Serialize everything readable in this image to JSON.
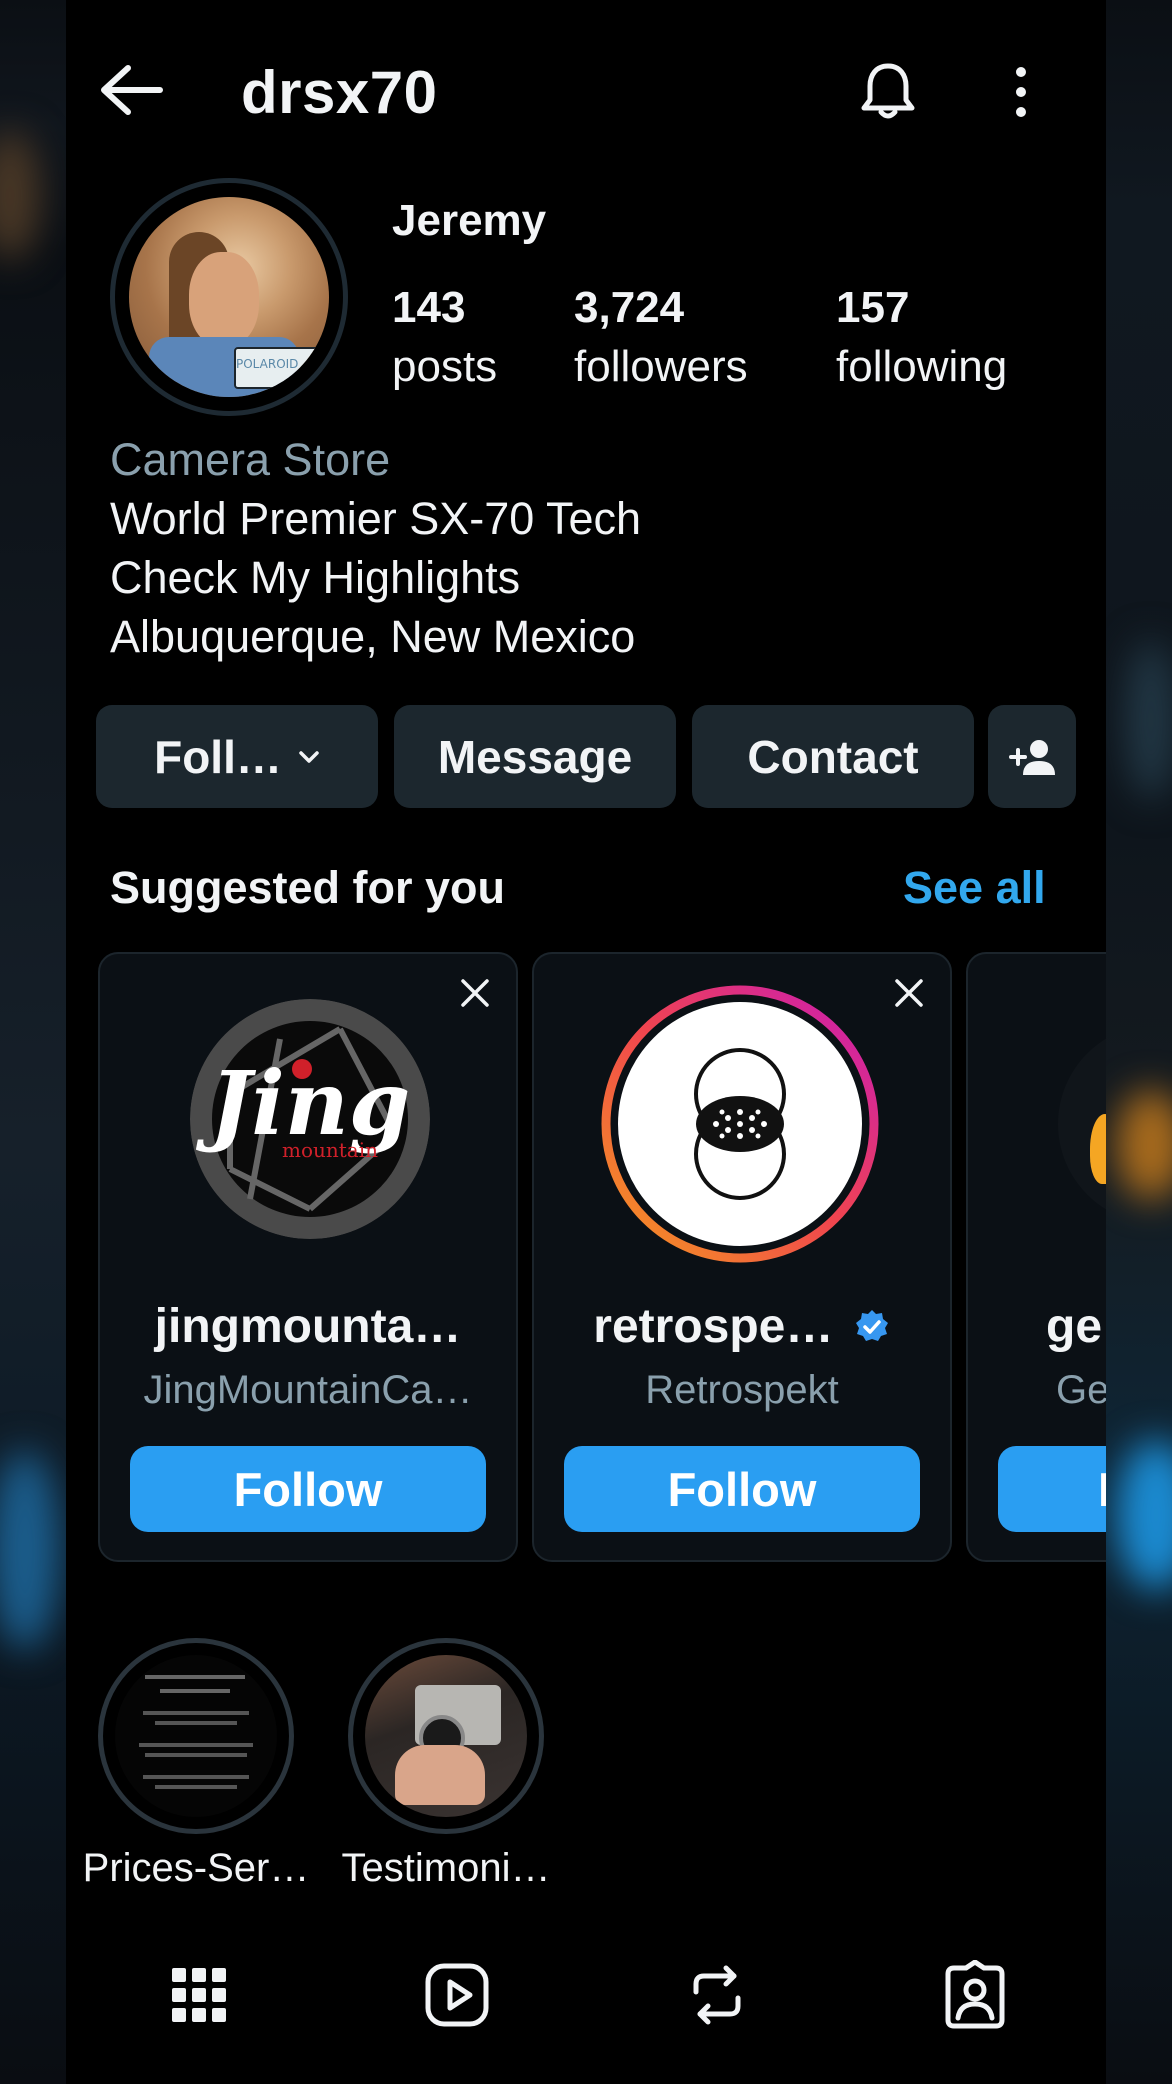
{
  "header": {
    "username": "drsx70"
  },
  "profile": {
    "display_name": "Jeremy",
    "stats": [
      {
        "num": "143",
        "label": "posts"
      },
      {
        "num": "3,724",
        "label": "followers"
      },
      {
        "num": "157",
        "label": "following"
      }
    ],
    "avatar_text": "POLAROID",
    "category": "Camera Store",
    "bio_lines": [
      "World Premier SX-70 Tech",
      "Check My Highlights",
      "Albuquerque, New Mexico"
    ]
  },
  "actions": {
    "follow": "Foll…",
    "message": "Message",
    "contact": "Contact"
  },
  "suggested": {
    "title": "Suggested for you",
    "see_all": "See all",
    "cards": [
      {
        "name": "jingmounta…",
        "sub": "JingMountainCa…",
        "button": "Follow",
        "logo_text": "Jing",
        "logo_sub": "mountain"
      },
      {
        "name": "retrospe…",
        "sub": "Retrospekt",
        "button": "Follow",
        "verified": true
      },
      {
        "name": "ge",
        "sub": "Ge",
        "button": "F"
      }
    ]
  },
  "highlights": [
    {
      "label": "Prices-Ser…"
    },
    {
      "label": "Testimoni…"
    }
  ],
  "colors": {
    "accent": "#2a9ef2",
    "link": "#32a8ee",
    "button_bg": "#1c272e"
  },
  "nav": [
    "grid-icon",
    "reels-icon",
    "reposts-icon",
    "tagged-icon"
  ]
}
